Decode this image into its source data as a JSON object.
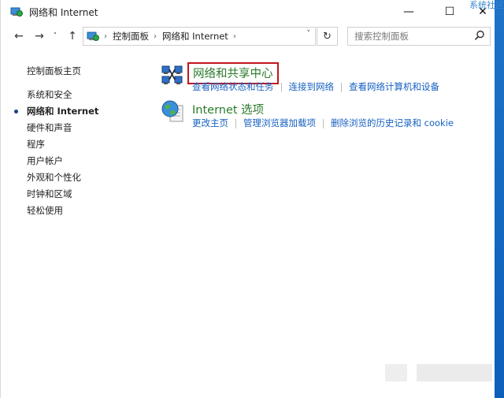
{
  "window": {
    "title": "网络和 Internet",
    "controls": {
      "minimize": "—",
      "maximize": "☐",
      "close": "✕"
    }
  },
  "watermark": "系统社区",
  "nav": {
    "back": "←",
    "forward": "→",
    "dropdown": "˅",
    "up": "↑",
    "breadcrumb": [
      "控制面板",
      "网络和 Internet"
    ],
    "breadcrumb_sep": "›",
    "refresh": "↻",
    "search_placeholder": "搜索控制面板"
  },
  "sidebar": {
    "items": [
      {
        "label": "控制面板主页"
      },
      {
        "label": "系统和安全"
      },
      {
        "label": "网络和 Internet",
        "active": true
      },
      {
        "label": "硬件和声音"
      },
      {
        "label": "程序"
      },
      {
        "label": "用户帐户"
      },
      {
        "label": "外观和个性化"
      },
      {
        "label": "时钟和区域"
      },
      {
        "label": "轻松使用"
      }
    ]
  },
  "categories": [
    {
      "title": "网络和共享中心",
      "icon": "network-sharing-icon",
      "highlighted": true,
      "links": [
        "查看网络状态和任务",
        "连接到网络",
        "查看网络计算机和设备"
      ]
    },
    {
      "title": "Internet 选项",
      "icon": "internet-options-icon",
      "links": [
        "更改主页",
        "管理浏览器加载项",
        "删除浏览的历史记录和 cookie"
      ]
    }
  ],
  "colors": {
    "category_title": "#2a7a2a",
    "link": "#1660c2",
    "highlight_box": "#c2161b",
    "desktop": "#1e73c8"
  }
}
